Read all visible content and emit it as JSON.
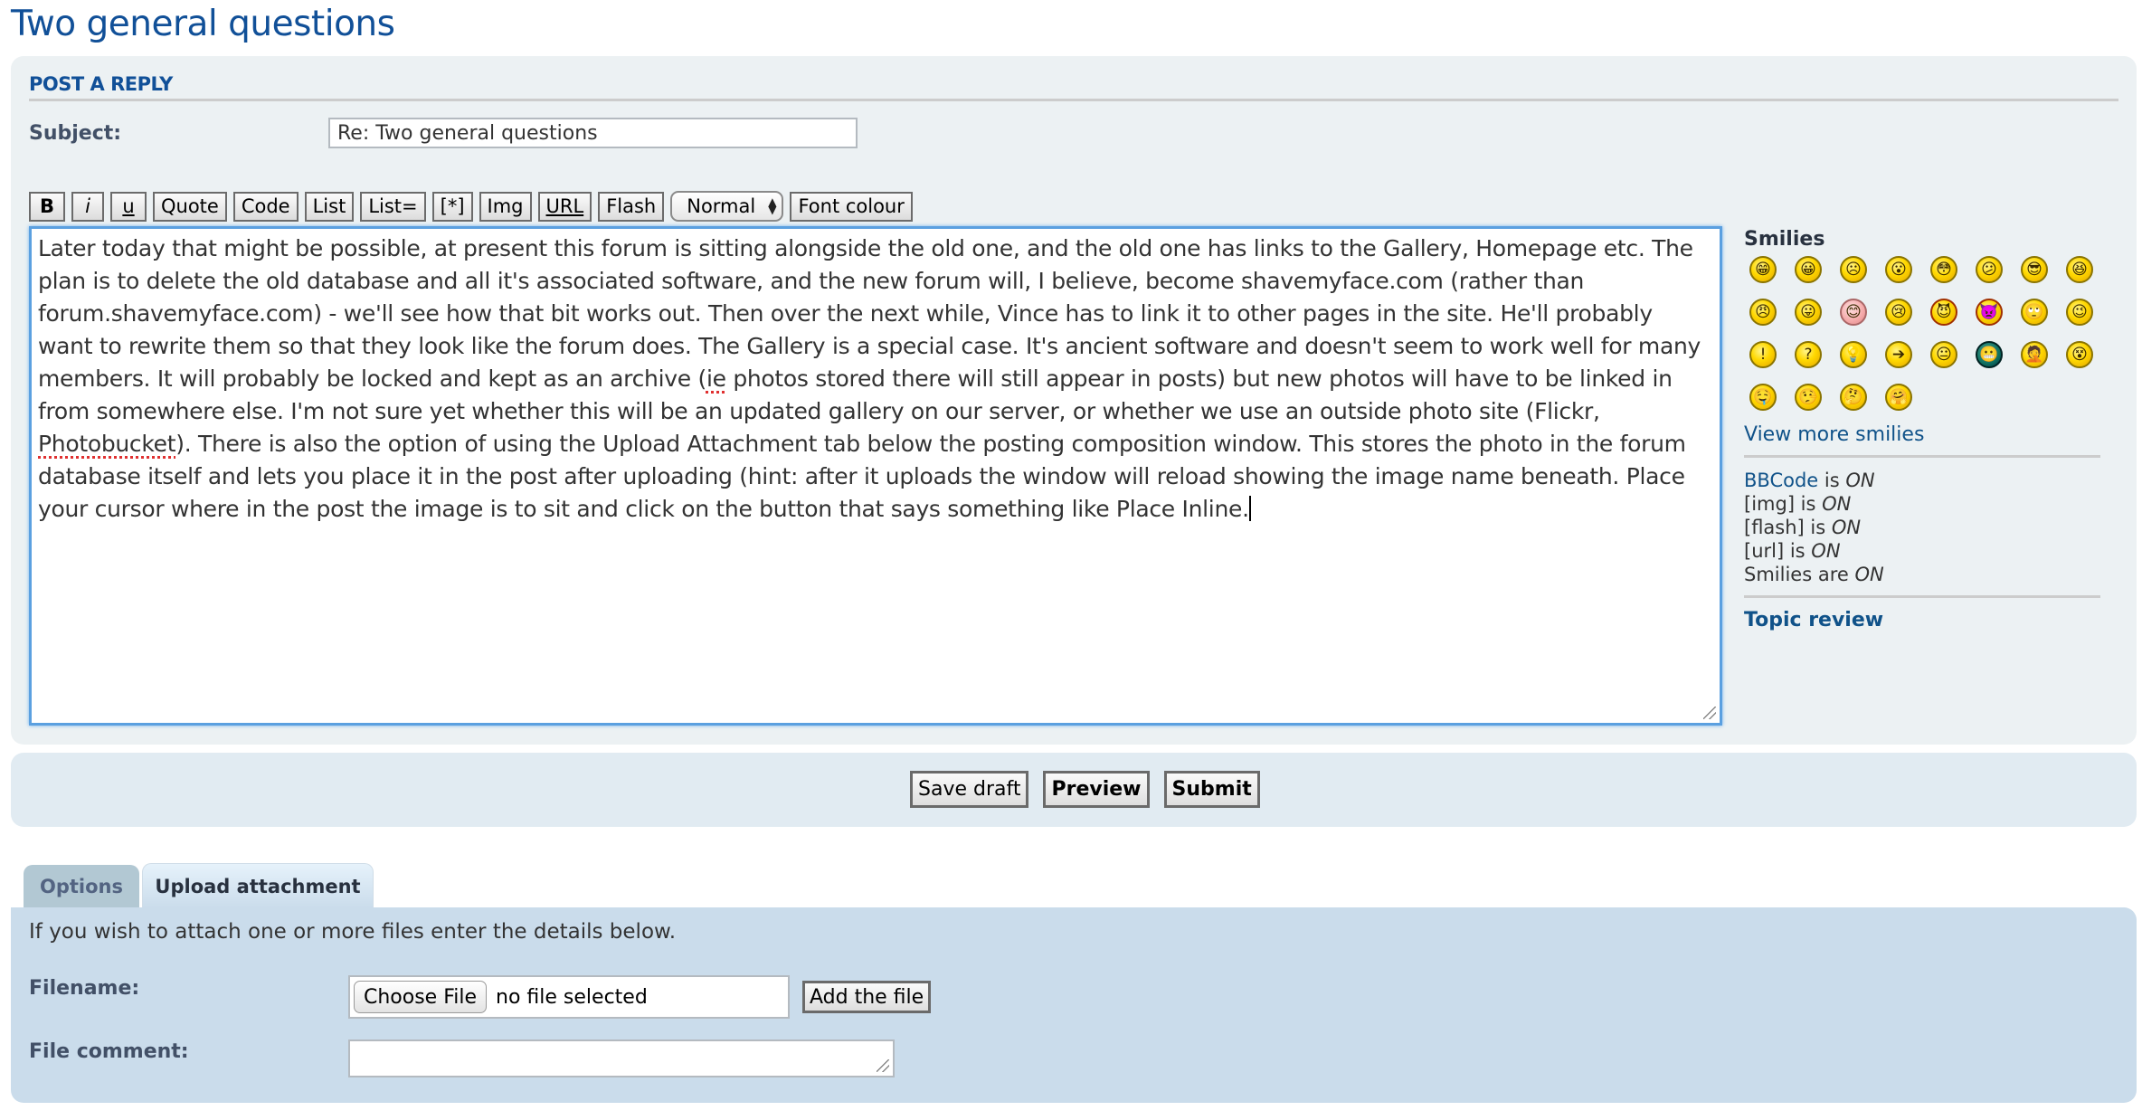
{
  "page": {
    "title": "Two general questions"
  },
  "reply": {
    "heading": "POST A REPLY",
    "subject_label": "Subject:",
    "subject_value": "Re: Two general questions"
  },
  "toolbar": {
    "buttons": [
      {
        "id": "bold",
        "label": "B"
      },
      {
        "id": "italic",
        "label": "i"
      },
      {
        "id": "underline",
        "label": "u"
      },
      {
        "id": "quote",
        "label": "Quote"
      },
      {
        "id": "code",
        "label": "Code"
      },
      {
        "id": "list",
        "label": "List"
      },
      {
        "id": "list-ordered",
        "label": "List="
      },
      {
        "id": "list-item",
        "label": "[*]"
      },
      {
        "id": "img",
        "label": "Img"
      },
      {
        "id": "url",
        "label": "URL"
      },
      {
        "id": "flash",
        "label": "Flash"
      }
    ],
    "font_size_selected": "Normal",
    "font_colour_label": "Font colour"
  },
  "message": {
    "before_ie": "Later today that might be possible, at present this forum is sitting alongside the old one, and the old one has links to the Gallery, Homepage etc. The plan is to delete the old database and all it's associated software, and the new forum will, I believe, become shavemyface.com (rather than\nforum.shavemyface.com) - we'll see how that bit works out. Then over the next while, Vince has to link it to other pages in the site. He'll probably want to rewrite them so that they look like the forum does. The Gallery is a special case. It's ancient software and doesn't seem to work well for many members. It will probably be locked and kept as an archive (",
    "misspelled_1": "ie",
    "between": " photos stored there will still appear in posts) but new photos will have to be linked in from somewhere else. I'm not sure yet whether this will be an updated gallery on our server, or whether we use an outside photo site (Flickr, ",
    "misspelled_2": "Photobucket",
    "after": "). There is also the option of using the Upload Attachment tab below the posting composition window. This stores the photo in the forum database itself and lets you place it in the post after uploading (hint: after it uploads the window will reload showing the image name beneath. Place your cursor where in the post the image is to sit and click on the button that says something like Place Inline."
  },
  "smilies": {
    "title": "Smilies",
    "items": [
      {
        "name": "very-happy",
        "glyph": "😁"
      },
      {
        "name": "smile",
        "glyph": "😀"
      },
      {
        "name": "sad",
        "glyph": "☹"
      },
      {
        "name": "surprised",
        "glyph": "😮"
      },
      {
        "name": "eek",
        "glyph": "😳"
      },
      {
        "name": "confused",
        "glyph": "😕"
      },
      {
        "name": "cool",
        "glyph": "😎"
      },
      {
        "name": "laughing",
        "glyph": "😆"
      },
      {
        "name": "mad",
        "glyph": "😠"
      },
      {
        "name": "razz",
        "glyph": "😛"
      },
      {
        "name": "embarrassed",
        "glyph": "😊"
      },
      {
        "name": "crying",
        "glyph": "😢"
      },
      {
        "name": "evil",
        "glyph": "😈"
      },
      {
        "name": "twisted-evil",
        "glyph": "👿"
      },
      {
        "name": "rolling-eyes",
        "glyph": "🙄"
      },
      {
        "name": "wink",
        "glyph": "😉"
      },
      {
        "name": "exclamation",
        "glyph": "!"
      },
      {
        "name": "question",
        "glyph": "?"
      },
      {
        "name": "idea",
        "glyph": "💡"
      },
      {
        "name": "arrow",
        "glyph": "➔"
      },
      {
        "name": "neutral",
        "glyph": "😐"
      },
      {
        "name": "mr-green",
        "glyph": "😬"
      },
      {
        "name": "geek",
        "glyph": "🤦"
      },
      {
        "name": "ugeek",
        "glyph": "😵"
      },
      {
        "name": "drool",
        "glyph": "🤤"
      },
      {
        "name": "liar",
        "glyph": "🤥"
      },
      {
        "name": "thinking",
        "glyph": "🤔"
      },
      {
        "name": "hug",
        "glyph": "🤗"
      }
    ],
    "view_more_label": "View more smilies"
  },
  "status": {
    "bbcode_link": "BBCode",
    "bbcode_rest": " is ",
    "img_label": "[img] is ",
    "flash_label": "[flash] is ",
    "url_label": "[url] is ",
    "smilies_label": "Smilies are ",
    "on": "ON"
  },
  "topic_review_label": "Topic review",
  "actions": {
    "save_draft": "Save draft",
    "preview": "Preview",
    "submit": "Submit"
  },
  "tabs": [
    {
      "label": "Options",
      "active": false
    },
    {
      "label": "Upload attachment",
      "active": true
    }
  ],
  "attachment": {
    "intro": "If you wish to attach one or more files enter the details below.",
    "filename_label": "Filename:",
    "choose_file_label": "Choose File",
    "no_file_text": "no file selected",
    "add_file_label": "Add the file",
    "comment_label": "File comment:",
    "comment_value": ""
  },
  "colors": {
    "brand_blue": "#115098",
    "link_blue": "#105289",
    "panel_bg": "#ECF1F3",
    "attach_bg": "#CADCEB",
    "focus_border": "#5BA0E0"
  }
}
